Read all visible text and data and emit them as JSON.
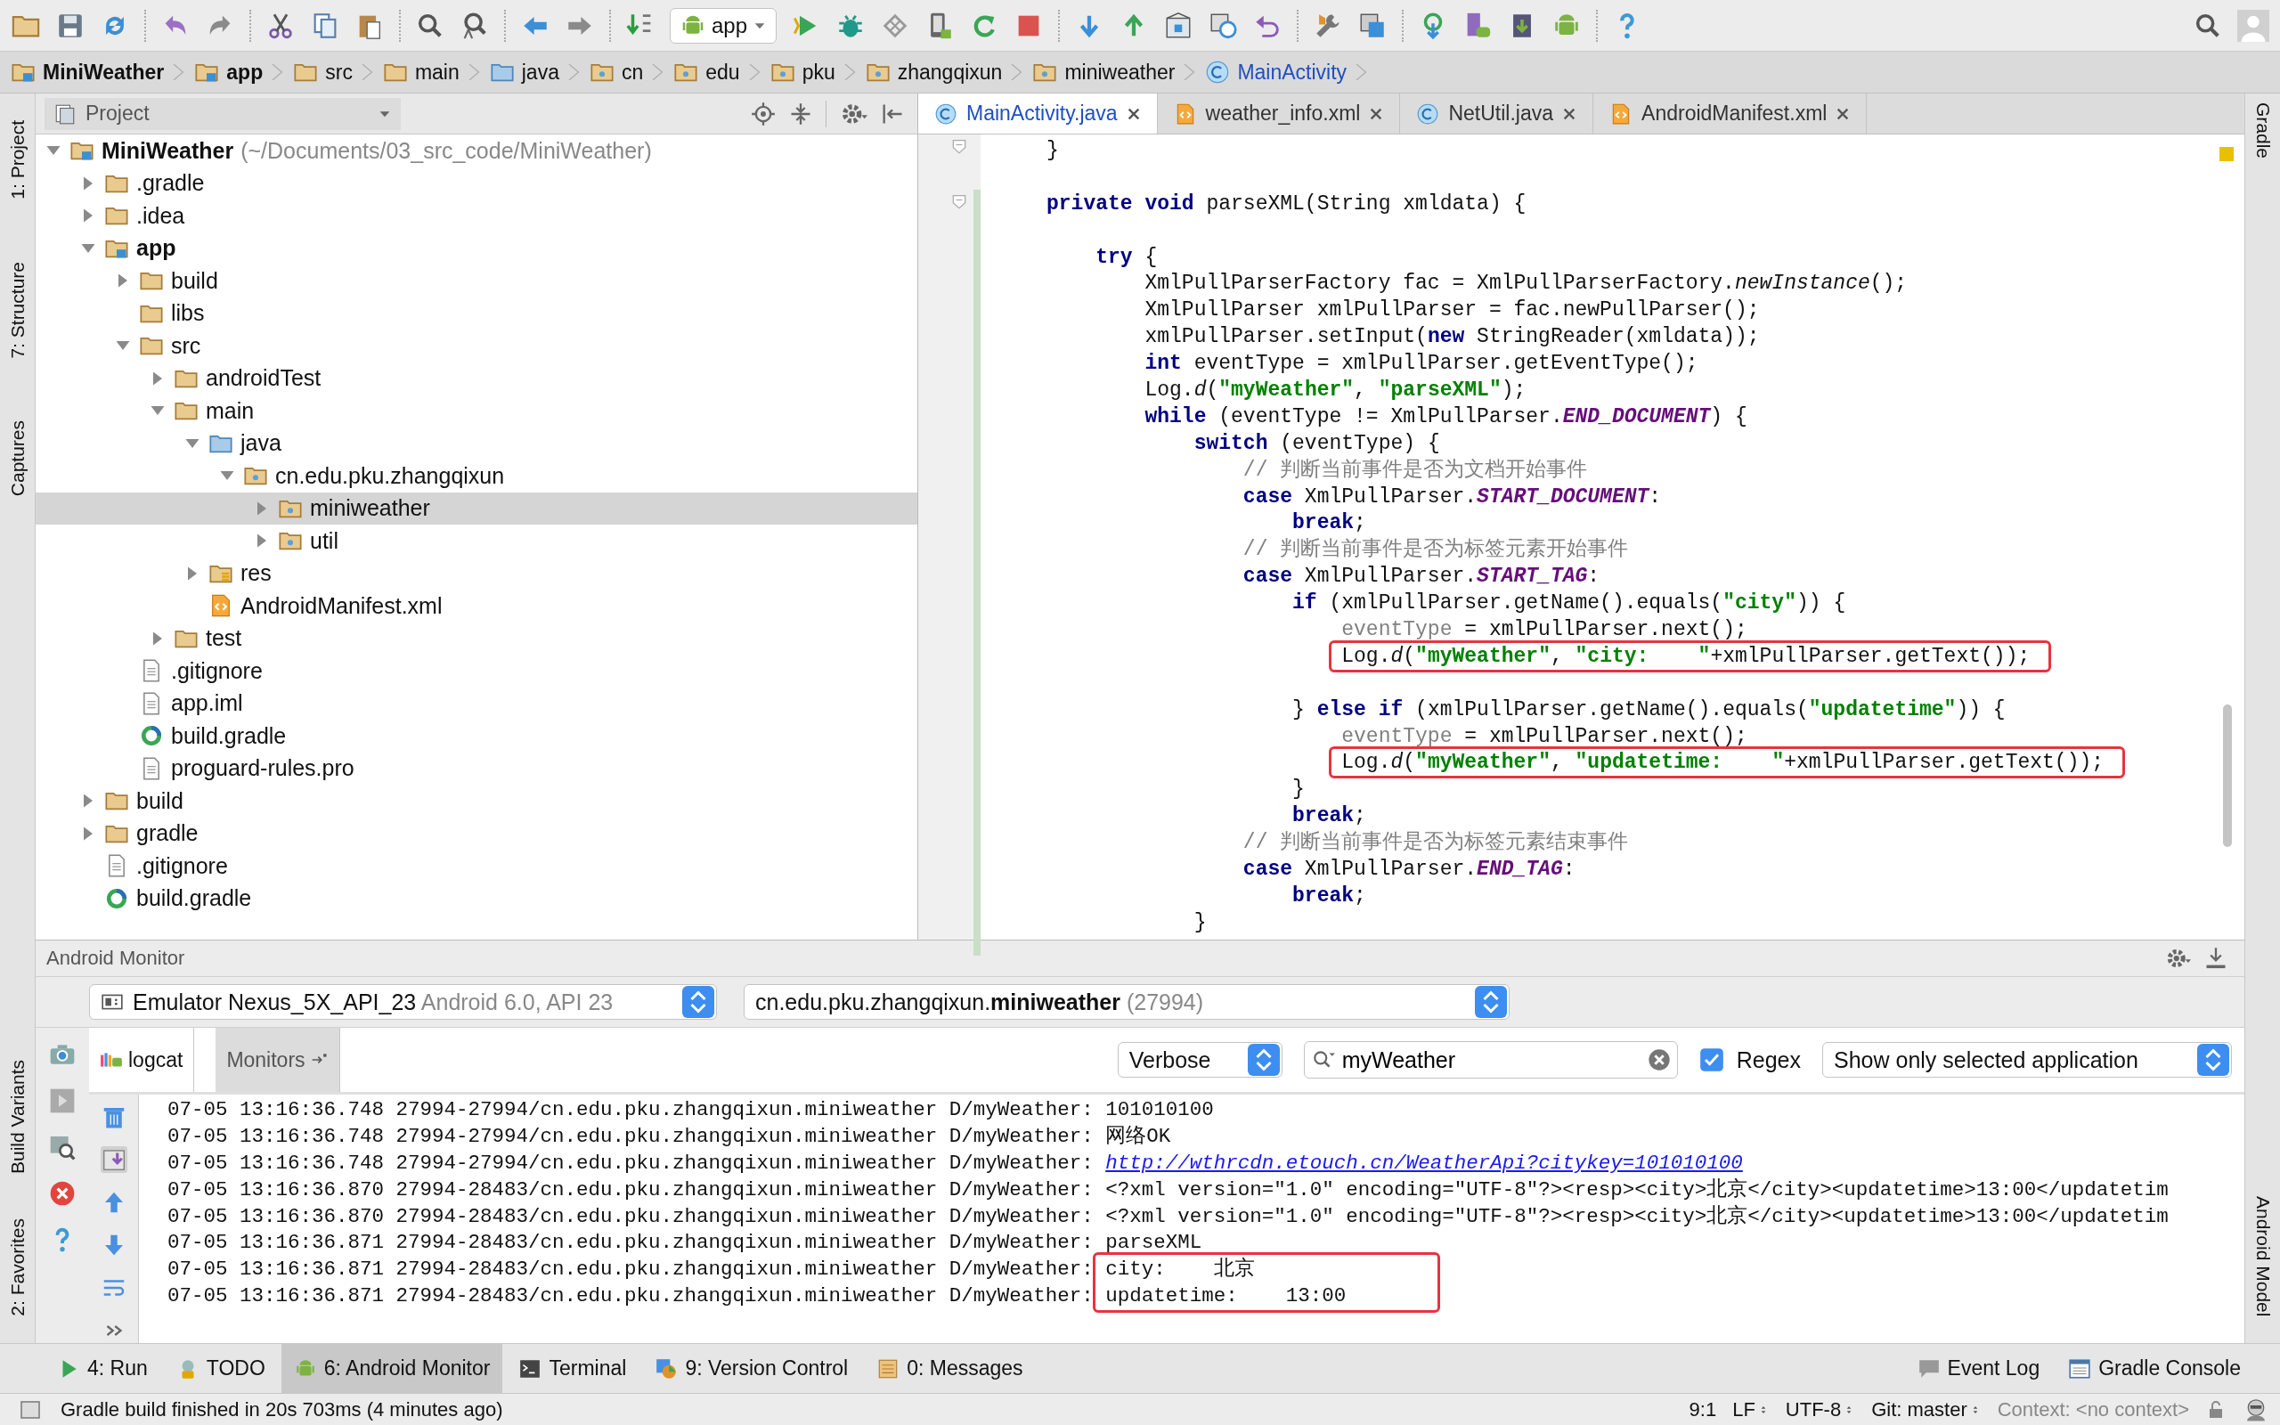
{
  "toolbar": {
    "run_config": "app"
  },
  "breadcrumb": [
    {
      "label": "MiniWeather",
      "kind": "module"
    },
    {
      "label": "app",
      "kind": "module"
    },
    {
      "label": "src",
      "kind": "folder"
    },
    {
      "label": "main",
      "kind": "folder"
    },
    {
      "label": "java",
      "kind": "source"
    },
    {
      "label": "cn",
      "kind": "package"
    },
    {
      "label": "edu",
      "kind": "package"
    },
    {
      "label": "pku",
      "kind": "package"
    },
    {
      "label": "zhangqixun",
      "kind": "package"
    },
    {
      "label": "miniweather",
      "kind": "package"
    },
    {
      "label": "MainActivity",
      "kind": "class"
    }
  ],
  "left_strip": {
    "top": [
      "1: Project",
      "7: Structure",
      "Captures"
    ],
    "bottom": [
      "Build Variants",
      "2: Favorites"
    ]
  },
  "right_strip": {
    "top": [
      "Gradle"
    ],
    "bottom": [
      "Android Model"
    ]
  },
  "project_panel": {
    "view": "Project",
    "tree": [
      {
        "label": "MiniWeather",
        "path": "(~/Documents/03_src_code/MiniWeather)",
        "kind": "module",
        "expanded": true,
        "selected": false,
        "children": [
          {
            "label": ".gradle",
            "kind": "folder",
            "expanded": false,
            "selected": false
          },
          {
            "label": ".idea",
            "kind": "folder",
            "expanded": false,
            "selected": false
          },
          {
            "label": "app",
            "kind": "module",
            "expanded": true,
            "selected": false,
            "children": [
              {
                "label": "build",
                "kind": "folder",
                "expanded": false,
                "selected": false
              },
              {
                "label": "libs",
                "kind": "folder",
                "selected": false
              },
              {
                "label": "src",
                "kind": "folder",
                "expanded": true,
                "selected": false,
                "children": [
                  {
                    "label": "androidTest",
                    "kind": "folder",
                    "expanded": false,
                    "selected": false
                  },
                  {
                    "label": "main",
                    "kind": "folder",
                    "expanded": true,
                    "selected": false,
                    "children": [
                      {
                        "label": "java",
                        "kind": "source",
                        "expanded": true,
                        "selected": false,
                        "children": [
                          {
                            "label": "cn.edu.pku.zhangqixun",
                            "kind": "package",
                            "expanded": true,
                            "selected": false,
                            "children": [
                              {
                                "label": "miniweather",
                                "kind": "package",
                                "expanded": false,
                                "selected": true
                              },
                              {
                                "label": "util",
                                "kind": "package",
                                "expanded": false,
                                "selected": false
                              }
                            ]
                          }
                        ]
                      },
                      {
                        "label": "res",
                        "kind": "resource",
                        "expanded": false,
                        "selected": false
                      },
                      {
                        "label": "AndroidManifest.xml",
                        "kind": "xml",
                        "selected": false
                      }
                    ]
                  },
                  {
                    "label": "test",
                    "kind": "folder",
                    "expanded": false,
                    "selected": false
                  }
                ]
              },
              {
                "label": ".gitignore",
                "kind": "file",
                "selected": false
              },
              {
                "label": "app.iml",
                "kind": "file",
                "selected": false
              },
              {
                "label": "build.gradle",
                "kind": "gradle",
                "selected": false
              },
              {
                "label": "proguard-rules.pro",
                "kind": "file",
                "selected": false
              }
            ]
          },
          {
            "label": "build",
            "kind": "folder",
            "expanded": false,
            "selected": false
          },
          {
            "label": "gradle",
            "kind": "folder",
            "expanded": false,
            "selected": false
          },
          {
            "label": ".gitignore",
            "kind": "file",
            "selected": false
          },
          {
            "label": "build.gradle",
            "kind": "gradle",
            "selected": false
          }
        ]
      }
    ]
  },
  "editor": {
    "tabs": [
      {
        "label": "MainActivity.java",
        "kind": "class",
        "selected": true
      },
      {
        "label": "weather_info.xml",
        "kind": "xml",
        "selected": false
      },
      {
        "label": "NetUtil.java",
        "kind": "class",
        "selected": false
      },
      {
        "label": "AndroidManifest.xml",
        "kind": "xml",
        "selected": false
      }
    ],
    "lines": [
      {
        "kind": "code",
        "highlighted": false,
        "segments": [
          {
            "kind": "plain",
            "text": "}"
          }
        ]
      },
      {
        "kind": "blank"
      },
      {
        "kind": "code",
        "highlighted": false,
        "segments": [
          {
            "kind": "keyword",
            "text": "private void"
          },
          {
            "kind": "plain",
            "text": " parseXML(String xmldata) {"
          }
        ]
      },
      {
        "kind": "blank"
      },
      {
        "kind": "code",
        "highlighted": false,
        "segments": [
          {
            "kind": "keyword",
            "text": "    try"
          },
          {
            "kind": "plain",
            "text": " {"
          }
        ]
      },
      {
        "kind": "code",
        "highlighted": false,
        "segments": [
          {
            "kind": "plain",
            "text": "        XmlPullParserFactory fac = XmlPullParserFactory."
          },
          {
            "kind": "call",
            "text": "newInstance"
          },
          {
            "kind": "plain",
            "text": "();"
          }
        ]
      },
      {
        "kind": "code",
        "highlighted": false,
        "segments": [
          {
            "kind": "plain",
            "text": "        XmlPullParser xmlPullParser = fac.newPullParser();"
          }
        ]
      },
      {
        "kind": "code",
        "highlighted": false,
        "segments": [
          {
            "kind": "plain",
            "text": "        xmlPullParser.setInput("
          },
          {
            "kind": "keyword",
            "text": "new"
          },
          {
            "kind": "plain",
            "text": " StringReader(xmldata));"
          }
        ]
      },
      {
        "kind": "code",
        "highlighted": false,
        "segments": [
          {
            "kind": "keyword",
            "text": "        int"
          },
          {
            "kind": "plain",
            "text": " eventType = xmlPullParser.getEventType();"
          }
        ]
      },
      {
        "kind": "code",
        "highlighted": false,
        "segments": [
          {
            "kind": "plain",
            "text": "        Log."
          },
          {
            "kind": "call",
            "text": "d"
          },
          {
            "kind": "plain",
            "text": "("
          },
          {
            "kind": "string",
            "text": "\"myWeather\""
          },
          {
            "kind": "plain",
            "text": ", "
          },
          {
            "kind": "string",
            "text": "\"parseXML\""
          },
          {
            "kind": "plain",
            "text": ");"
          }
        ]
      },
      {
        "kind": "code",
        "highlighted": false,
        "segments": [
          {
            "kind": "keyword",
            "text": "        while"
          },
          {
            "kind": "plain",
            "text": " (eventType != XmlPullParser."
          },
          {
            "kind": "constant",
            "text": "END_DOCUMENT"
          },
          {
            "kind": "plain",
            "text": ") {"
          }
        ]
      },
      {
        "kind": "code",
        "highlighted": false,
        "segments": [
          {
            "kind": "keyword",
            "text": "            switch"
          },
          {
            "kind": "plain",
            "text": " (eventType) {"
          }
        ]
      },
      {
        "kind": "code",
        "highlighted": false,
        "segments": [
          {
            "kind": "comment",
            "text": "                // 判断当前事件是否为文档开始事件"
          }
        ]
      },
      {
        "kind": "code",
        "highlighted": false,
        "segments": [
          {
            "kind": "keyword",
            "text": "                case"
          },
          {
            "kind": "plain",
            "text": " XmlPullParser."
          },
          {
            "kind": "constant",
            "text": "START_DOCUMENT"
          },
          {
            "kind": "plain",
            "text": ":"
          }
        ]
      },
      {
        "kind": "code",
        "highlighted": false,
        "segments": [
          {
            "kind": "keyword",
            "text": "                    break"
          },
          {
            "kind": "plain",
            "text": ";"
          }
        ]
      },
      {
        "kind": "code",
        "highlighted": false,
        "segments": [
          {
            "kind": "comment",
            "text": "                // 判断当前事件是否为标签元素开始事件"
          }
        ]
      },
      {
        "kind": "code",
        "highlighted": false,
        "segments": [
          {
            "kind": "keyword",
            "text": "                case"
          },
          {
            "kind": "plain",
            "text": " XmlPullParser."
          },
          {
            "kind": "constant",
            "text": "START_TAG"
          },
          {
            "kind": "plain",
            "text": ":"
          }
        ]
      },
      {
        "kind": "code",
        "highlighted": false,
        "segments": [
          {
            "kind": "keyword",
            "text": "                    if"
          },
          {
            "kind": "plain",
            "text": " (xmlPullParser.getName().equals("
          },
          {
            "kind": "string",
            "text": "\"city\""
          },
          {
            "kind": "plain",
            "text": ")) {"
          }
        ]
      },
      {
        "kind": "code",
        "highlighted": false,
        "segments": [
          {
            "kind": "unused",
            "text": "                        eventType"
          },
          {
            "kind": "plain",
            "text": " = xmlPullParser.next();"
          }
        ]
      },
      {
        "kind": "code",
        "highlighted": true,
        "segments": [
          {
            "kind": "plain",
            "text": "                        Log."
          },
          {
            "kind": "call",
            "text": "d"
          },
          {
            "kind": "plain",
            "text": "("
          },
          {
            "kind": "string",
            "text": "\"myWeather\""
          },
          {
            "kind": "plain",
            "text": ", "
          },
          {
            "kind": "string",
            "text": "\"city:    \""
          },
          {
            "kind": "plain",
            "text": "+xmlPullParser.getText());"
          }
        ]
      },
      {
        "kind": "blank"
      },
      {
        "kind": "code",
        "highlighted": false,
        "segments": [
          {
            "kind": "plain",
            "text": "                    } "
          },
          {
            "kind": "keyword",
            "text": "else if"
          },
          {
            "kind": "plain",
            "text": " (xmlPullParser.getName().equals("
          },
          {
            "kind": "string",
            "text": "\"updatetime\""
          },
          {
            "kind": "plain",
            "text": ")) {"
          }
        ]
      },
      {
        "kind": "code",
        "highlighted": false,
        "segments": [
          {
            "kind": "unused",
            "text": "                        eventType"
          },
          {
            "kind": "plain",
            "text": " = xmlPullParser.next();"
          }
        ]
      },
      {
        "kind": "code",
        "highlighted": true,
        "segments": [
          {
            "kind": "plain",
            "text": "                        Log."
          },
          {
            "kind": "call",
            "text": "d"
          },
          {
            "kind": "plain",
            "text": "("
          },
          {
            "kind": "string",
            "text": "\"myWeather\""
          },
          {
            "kind": "plain",
            "text": ", "
          },
          {
            "kind": "string",
            "text": "\"updatetime:    \""
          },
          {
            "kind": "plain",
            "text": "+xmlPullParser.getText());"
          }
        ]
      },
      {
        "kind": "code",
        "highlighted": false,
        "segments": [
          {
            "kind": "plain",
            "text": "                    }"
          }
        ]
      },
      {
        "kind": "code",
        "highlighted": false,
        "segments": [
          {
            "kind": "keyword",
            "text": "                    break"
          },
          {
            "kind": "plain",
            "text": ";"
          }
        ]
      },
      {
        "kind": "code",
        "highlighted": false,
        "segments": [
          {
            "kind": "comment",
            "text": "                // 判断当前事件是否为标签元素结束事件"
          }
        ]
      },
      {
        "kind": "code",
        "highlighted": false,
        "segments": [
          {
            "kind": "keyword",
            "text": "                case"
          },
          {
            "kind": "plain",
            "text": " XmlPullParser."
          },
          {
            "kind": "constant",
            "text": "END_TAG"
          },
          {
            "kind": "plain",
            "text": ":"
          }
        ]
      },
      {
        "kind": "code",
        "highlighted": false,
        "segments": [
          {
            "kind": "keyword",
            "text": "                    break"
          },
          {
            "kind": "plain",
            "text": ";"
          }
        ]
      },
      {
        "kind": "code",
        "highlighted": false,
        "segments": [
          {
            "kind": "plain",
            "text": "            }"
          }
        ]
      }
    ]
  },
  "android_monitor": {
    "title": "Android Monitor",
    "device": {
      "name": "Emulator Nexus_5X_API_23",
      "detail": "Android 6.0, API 23"
    },
    "process": {
      "name": "cn.edu.pku.zhangqixun.**miniweather**",
      "pid": "(27994)"
    },
    "tabs": [
      {
        "label": "logcat",
        "selected": true
      },
      {
        "label": "Monitors",
        "selected": false
      }
    ],
    "log_level": "Verbose",
    "search": {
      "value": "myWeather"
    },
    "regex": {
      "label": "Regex",
      "checked": true
    },
    "filter": "Show only selected application",
    "lines": [
      {
        "prefix": "07-05 13:16:36.748 27994-27994/cn.edu.pku.zhangqixun.miniweather D/myWeather: ",
        "message": "101010100",
        "kind": "text",
        "highlighted": false
      },
      {
        "prefix": "07-05 13:16:36.748 27994-27994/cn.edu.pku.zhangqixun.miniweather D/myWeather: ",
        "message": "网络OK",
        "kind": "text",
        "highlighted": false
      },
      {
        "prefix": "07-05 13:16:36.748 27994-27994/cn.edu.pku.zhangqixun.miniweather D/myWeather: ",
        "message": "http://wthrcdn.etouch.cn/WeatherApi?citykey=101010100",
        "kind": "link",
        "highlighted": false
      },
      {
        "prefix": "07-05 13:16:36.870 27994-28483/cn.edu.pku.zhangqixun.miniweather D/myWeather: ",
        "message": "<?xml version=\"1.0\" encoding=\"UTF-8\"?><resp><city>北京</city><updatetime>13:00</updatetim",
        "kind": "text",
        "highlighted": false
      },
      {
        "prefix": "07-05 13:16:36.870 27994-28483/cn.edu.pku.zhangqixun.miniweather D/myWeather: ",
        "message": "<?xml version=\"1.0\" encoding=\"UTF-8\"?><resp><city>北京</city><updatetime>13:00</updatetim",
        "kind": "text",
        "highlighted": false
      },
      {
        "prefix": "07-05 13:16:36.871 27994-28483/cn.edu.pku.zhangqixun.miniweather D/myWeather: ",
        "message": "parseXML",
        "kind": "text",
        "highlighted": false
      },
      {
        "prefix": "07-05 13:16:36.871 27994-28483/cn.edu.pku.zhangqixun.miniweather D/myWeather: ",
        "message": "city:    北京",
        "kind": "text",
        "highlighted": true
      },
      {
        "prefix": "07-05 13:16:36.871 27994-28483/cn.edu.pku.zhangqixun.miniweather D/myWeather: ",
        "message": "updatetime:    13:00",
        "kind": "text",
        "highlighted": true
      }
    ]
  },
  "tool_buttons": {
    "left": [
      {
        "label": "4: Run",
        "kind": "run",
        "selected": false
      },
      {
        "label": "TODO",
        "kind": "todo",
        "selected": false
      },
      {
        "label": "6: Android Monitor",
        "kind": "android",
        "selected": true
      },
      {
        "label": "Terminal",
        "kind": "terminal",
        "selected": false
      },
      {
        "label": "9: Version Control",
        "kind": "vcs",
        "selected": false
      },
      {
        "label": "0: Messages",
        "kind": "messages",
        "selected": false
      }
    ],
    "right": [
      {
        "label": "Event Log",
        "kind": "event-log",
        "selected": false
      },
      {
        "label": "Gradle Console",
        "kind": "console",
        "selected": false
      }
    ]
  },
  "status_bar": {
    "message": "Gradle build finished in 20s 703ms (4 minutes ago)",
    "position": "9:1",
    "line_separator": "LF",
    "encoding": "UTF-8",
    "vcs": "Git: master",
    "context": "Context: <no context>"
  }
}
